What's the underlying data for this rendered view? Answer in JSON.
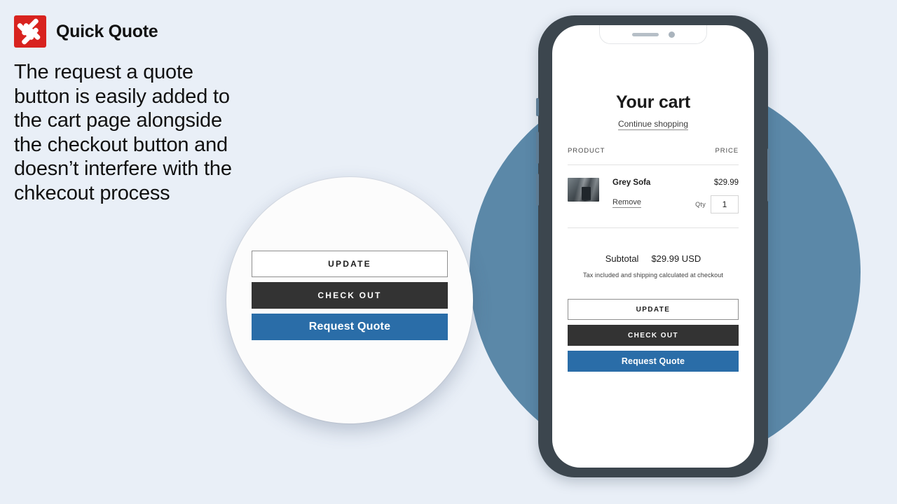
{
  "brand": {
    "name": "Quick Quote",
    "logo_icon": "quick-quote-logo-icon",
    "logo_color": "#d8231f"
  },
  "headline": "The request a quote button is easily added to the cart page alongside the checkout button and doesn’t interfere with the chkecout process",
  "colors": {
    "background": "#e9eff7",
    "accent_circle": "#5b88a8",
    "quote_button": "#2a6da8",
    "checkout_button": "#333333",
    "phone_frame": "#3c464e"
  },
  "phone": {
    "notch": {
      "speaker_icon": "speaker-grill-icon",
      "camera_icon": "front-camera-icon"
    },
    "side_buttons": [
      "silent-switch",
      "volume-up-button",
      "volume-down-button",
      "power-button"
    ]
  },
  "cart": {
    "title": "Your cart",
    "continue_shopping": "Continue shopping",
    "columns": {
      "product": "PRODUCT",
      "price": "PRICE"
    },
    "items": [
      {
        "name": "Grey Sofa",
        "price": "$29.99",
        "remove_label": "Remove",
        "qty_label": "Qty",
        "qty_value": "1",
        "thumbnail_icon": "product-thumbnail-image"
      }
    ],
    "subtotal_label": "Subtotal",
    "subtotal_value": "$29.99 USD",
    "tax_note": "Tax included and shipping calculated at checkout",
    "actions": {
      "update": "UPDATE",
      "checkout": "CHECK OUT",
      "request_quote": "Request Quote"
    }
  },
  "magnifier": {
    "update": "UPDATE",
    "checkout": "CHECK OUT",
    "request_quote": "Request Quote"
  }
}
